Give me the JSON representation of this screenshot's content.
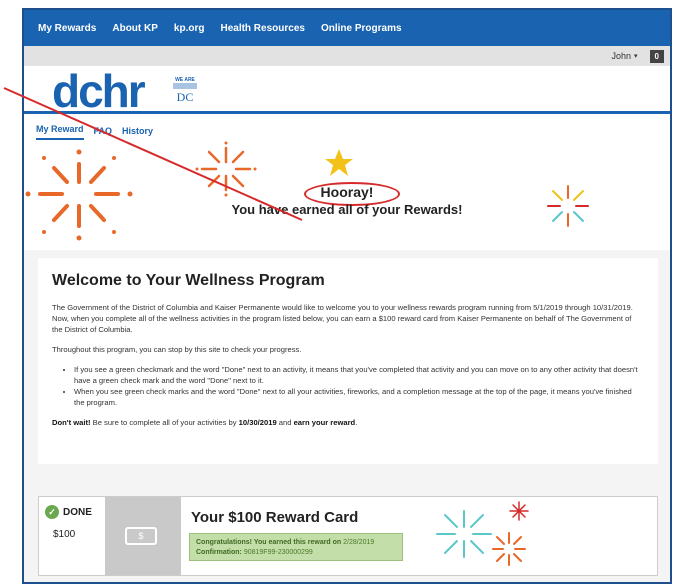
{
  "topnav": {
    "items": [
      "My Rewards",
      "About KP",
      "kp.org",
      "Health Resources",
      "Online Programs"
    ]
  },
  "userbar": {
    "user_name": "John",
    "caret": "▾",
    "badge_count": "0"
  },
  "brand": {
    "logo": "dchr",
    "dc_mark_top": "WE ARE",
    "dc_mark_bottom": "DC"
  },
  "subtabs": [
    "My Reward",
    "FAQ",
    "History"
  ],
  "hero": {
    "hooray": "Hooray!",
    "earned": "You have earned all of your Rewards!"
  },
  "welcome": {
    "title": "Welcome to Your Wellness Program",
    "intro": "The Government of the District of Columbia and Kaiser Permanente would like to welcome you to your wellness rewards program running from 5/1/2019 through 10/31/2019. Now, when you complete all of the wellness activities in the program listed below, you can earn a $100 reward card from Kaiser Permanente on behalf of The Government of the District of Columbia.",
    "throughout": "Throughout this program, you can stop by this site to check your progress.",
    "bullets": [
      "If you see a green checkmark and the word \"Done\" next to an activity, it means that you've completed that activity and you can move on to any other activity that doesn't have a green check mark and the word \"Done\" next to it.",
      "When you see green check marks and the word \"Done\" next to all your activities, fireworks, and a completion message at the top of the page, it means you've finished the program."
    ],
    "final_lead": "Don't wait!",
    "final_mid": " Be sure to complete all of your activities by ",
    "final_date": "10/30/2019",
    "final_and": " and ",
    "final_reward": "earn your reward",
    "final_end": "."
  },
  "reward_card": {
    "status": "DONE",
    "amount": "$100",
    "money_icon": "$",
    "title": "Your $100 Reward Card",
    "congrats_lead": "Congratulations! You earned this reward on",
    "congrats_date": "2/28/2019",
    "confirmation_label": "Confirmation:",
    "confirmation_value": "90819F99-230000299"
  },
  "colors": {
    "nav_blue": "#1a63b0",
    "done_green": "#6aa84f",
    "annotation_red": "#d62a2a",
    "firework_orange": "#e8682a",
    "firework_teal": "#5cc6c9"
  }
}
